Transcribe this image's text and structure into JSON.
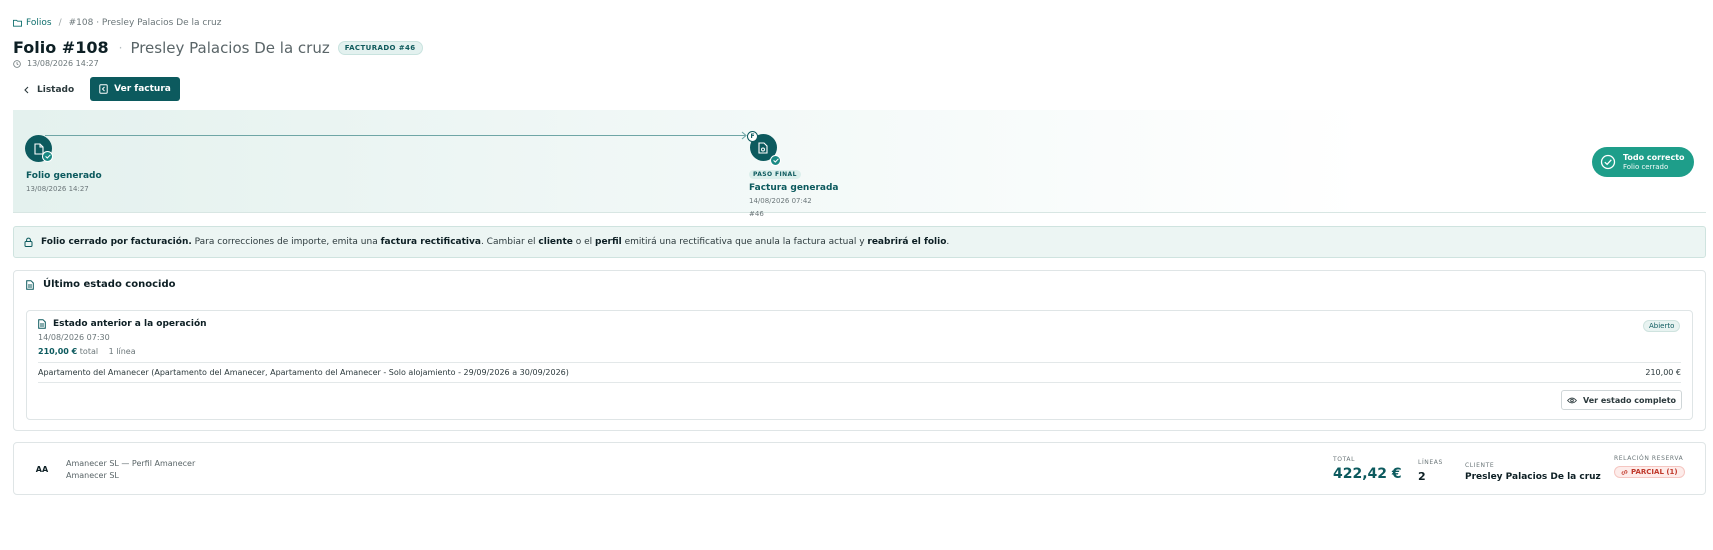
{
  "breadcrumb": {
    "root": "Folios",
    "separator": "/",
    "current": "#108 · Presley Palacios De la cruz"
  },
  "header": {
    "title": "Folio #108",
    "separator": "·",
    "client": "Presley Palacios De la cruz",
    "badge": "FACTURADO #46",
    "date": "13/08/2026 14:27"
  },
  "actions": {
    "back_label": "Listado",
    "invoice_label": "Ver factura"
  },
  "timeline": {
    "steps": [
      {
        "label": "Folio generado",
        "date": "13/08/2026 14:27"
      },
      {
        "badge": "PASO FINAL",
        "label": "Factura generada",
        "date": "14/08/2026 07:42",
        "ref": "#46",
        "flag": "F"
      }
    ],
    "status_title": "Todo correcto",
    "status_sub": "Folio cerrado"
  },
  "banner": {
    "b1": "Folio cerrado por facturación.",
    "t1": " Para correcciones de importe, emita una ",
    "b2": "factura rectificativa",
    "t2": ". Cambiar el ",
    "b3": "cliente",
    "t3": " o el ",
    "b4": "perfil",
    "t4": " emitirá una rectificativa que anula la factura actual y ",
    "b5": "reabrirá el folio",
    "t5": "."
  },
  "last_state": {
    "header": "Último estado conocido",
    "title": "Estado anterior a la operación",
    "date": "14/08/2026 07:30",
    "amount": "210,00 €",
    "amount_suffix": "total",
    "lines": "1 línea",
    "status": "Abierto",
    "line_description": "Apartamento del Amanecer (Apartamento del Amanecer, Apartamento del Amanecer - Solo alojamiento - 29/09/2026 a 30/09/2026)",
    "line_amount": "210,00 €",
    "full_button": "Ver estado completo"
  },
  "summary": {
    "initials": "AA",
    "company_line": "Amanecer SL — Perfil Amanecer",
    "company_sub": "Amanecer SL",
    "total_label": "TOTAL",
    "total_value": "422,42 €",
    "lines_label": "LÍNEAS",
    "lines_value": "2",
    "client_label": "CLIENTE",
    "client_value": "Presley Palacios De la cruz",
    "relation_label": "RELACIÓN RESERVA",
    "relation_value": "PARCIAL (1)"
  },
  "colors": {
    "brand": "#0c5a5e",
    "success": "#1e9e8a",
    "warning": "#c0392b"
  }
}
